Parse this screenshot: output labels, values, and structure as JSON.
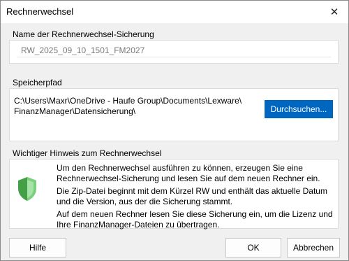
{
  "window": {
    "title": "Rechnerwechsel",
    "close_symbol": "✕"
  },
  "backup_name": {
    "label": "Name der Rechnerwechsel-Sicherung",
    "value": "RW_2025_09_10_1501_FM2027"
  },
  "storage_path": {
    "label": "Speicherpfad",
    "path": "C:\\Users\\Maxr\\OneDrive - Haufe Group\\Documents\\Lexware\\\nFinanzManager\\Datensicherung\\",
    "browse_label": "Durchsuchen..."
  },
  "notice": {
    "label": "Wichtiger Hinweis zum Rechnerwechsel",
    "icon": "shield-icon",
    "paragraphs": [
      "Um den Rechnerwechsel ausführen zu können, erzeugen Sie eine Rechnerwechsel-Sicherung und lesen Sie auf dem neuen Rechner ein.",
      "Die Zip-Datei beginnt mit dem Kürzel RW und enthält das aktuelle Datum und die Version, aus der die Sicherung stammt.",
      "Auf dem neuen Rechner lesen Sie diese Sicherung ein, um die Lizenz und Ihre FinanzManager-Dateien zu übertragen."
    ]
  },
  "buttons": {
    "help": "Hilfe",
    "ok": "OK",
    "cancel": "Abbrechen"
  },
  "colors": {
    "accent": "#0067c0",
    "shield_green": "#4caf50"
  }
}
